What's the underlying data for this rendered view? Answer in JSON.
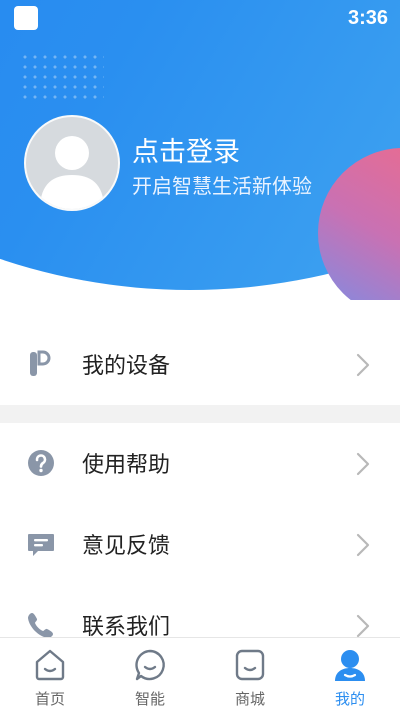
{
  "status_bar": {
    "time": "3:36"
  },
  "profile": {
    "login_title": "点击登录",
    "login_subtitle": "开启智慧生活新体验"
  },
  "menu": {
    "items": [
      {
        "label": "我的设备",
        "icon": "device-icon"
      },
      {
        "label": "使用帮助",
        "icon": "help-icon"
      },
      {
        "label": "意见反馈",
        "icon": "feedback-icon"
      },
      {
        "label": "联系我们",
        "icon": "phone-icon"
      }
    ]
  },
  "tabbar": {
    "tabs": [
      {
        "label": "首页",
        "icon": "home-icon",
        "active": false
      },
      {
        "label": "智能",
        "icon": "smart-icon",
        "active": false
      },
      {
        "label": "商城",
        "icon": "mall-icon",
        "active": false
      },
      {
        "label": "我的",
        "icon": "profile-icon",
        "active": true
      }
    ]
  },
  "colors": {
    "header_blue": "#1f7bf2",
    "header_light_blue": "#4fb2f0",
    "accent_pink": "#f26a86",
    "active_tab": "#2c8ef0",
    "inactive_tab": "#666666",
    "icon_gray": "#8a96a8"
  }
}
